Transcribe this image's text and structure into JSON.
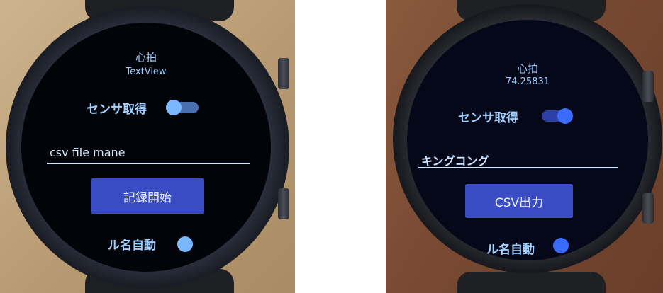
{
  "left_watch": {
    "heart_rate_title": "心拍",
    "heart_rate_value": "TextView",
    "sensor_label": "センサ取得",
    "sensor_on": true,
    "file_name_value": "csv file mane",
    "record_button": "記録開始",
    "cut_off_label": "ル名自動"
  },
  "right_watch": {
    "heart_rate_title": "心拍",
    "heart_rate_value": "74.25831",
    "sensor_label": "センサ取得",
    "sensor_on": true,
    "file_name_value": "キングコング",
    "output_button": "CSV出力",
    "cut_off_label": "ル名自動"
  },
  "colors": {
    "text_blue": "#9fd0ff",
    "button_blue": "#3a4cc4",
    "switch_thumb_left": "#79b8ff",
    "switch_thumb_right": "#3a6bff"
  }
}
